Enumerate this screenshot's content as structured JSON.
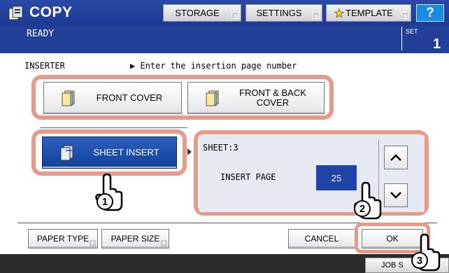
{
  "header": {
    "title": "COPY",
    "buttons": [
      {
        "label": "STORAGE"
      },
      {
        "label": "SETTINGS"
      },
      {
        "label": "TEMPLATE"
      }
    ],
    "help_label": "?",
    "status": "READY",
    "set_label": "SET",
    "set_count": "1"
  },
  "main": {
    "section_label": "INSERTER",
    "instruction": "▶ Enter the insertion page number",
    "front_cover_label": "FRONT COVER",
    "front_back_cover_label": "FRONT & BACK\nCOVER",
    "sheet_insert_label": "SHEET INSERT",
    "sheet_text": "SHEET:3",
    "insert_page_label": "INSERT PAGE",
    "insert_page_value": "25"
  },
  "footer": {
    "paper_type_label": "PAPER TYPE",
    "paper_size_label": "PAPER SIZE",
    "cancel_label": "CANCEL",
    "ok_label": "OK",
    "job_tab_label": "JOB S"
  },
  "step_markers": [
    "1",
    "2",
    "3"
  ],
  "colors": {
    "header_bg": "#1f3b8f",
    "selected_button": "#1f4fb0",
    "highlight_frame": "#e89a8a",
    "value_box": "#1f43a8"
  }
}
